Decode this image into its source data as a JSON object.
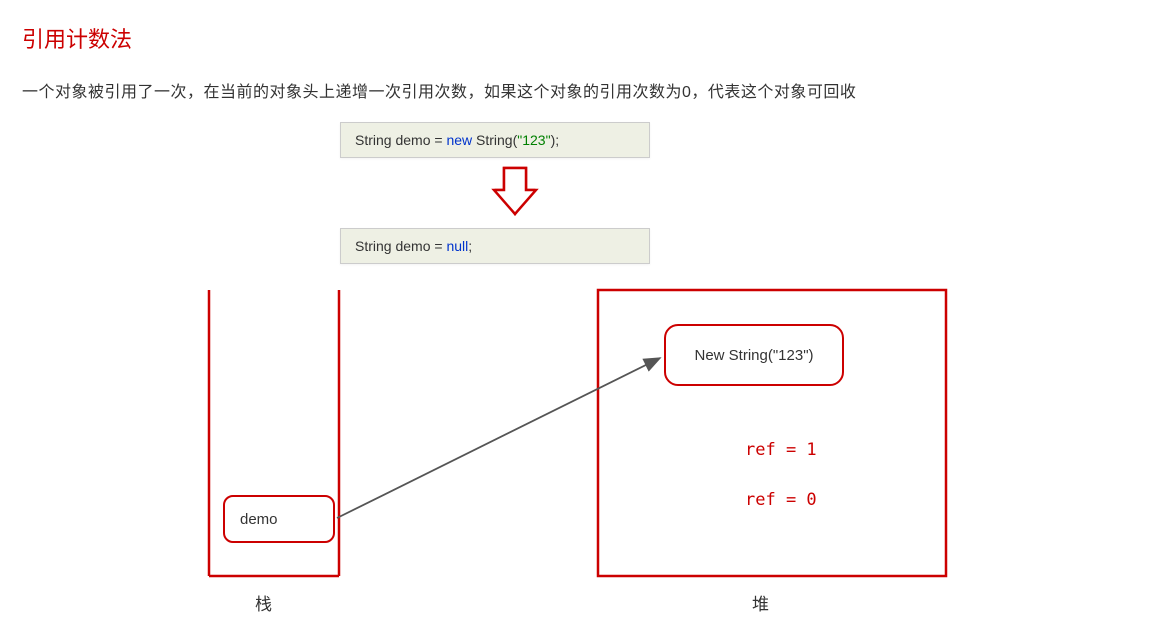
{
  "title": "引用计数法",
  "description": "一个对象被引用了一次，在当前的对象头上递增一次引用次数，如果这个对象的引用次数为0，代表这个对象可回收",
  "code1": {
    "prefix": "String demo = ",
    "kw": "new",
    "mid": " String(",
    "str": "\"123\"",
    "suffix": ");"
  },
  "code2": {
    "prefix": "String demo = ",
    "kw": "null",
    "suffix": ";"
  },
  "stack_label": "栈",
  "heap_label": "堆",
  "stack_item": "demo",
  "heap_item": "New String(\"123\")",
  "ref1": "ref = 1",
  "ref0": "ref = 0"
}
